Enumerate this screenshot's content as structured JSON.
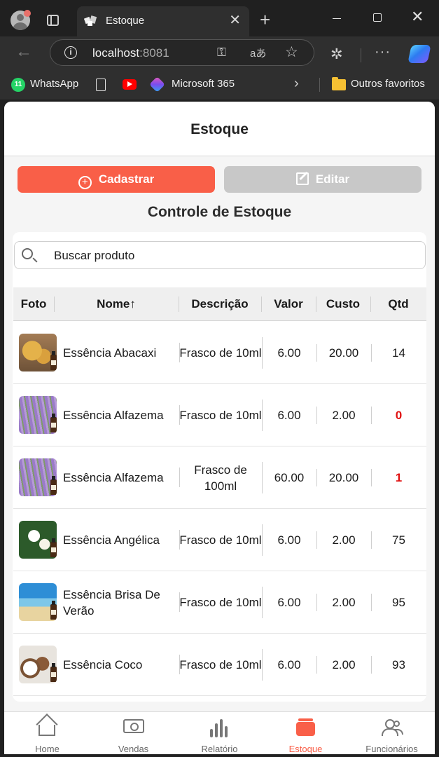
{
  "browser": {
    "tab_title": "Estoque",
    "url_host": "localhost",
    "url_port": ":8081",
    "bookmarks": [
      "WhatsApp",
      "Microsoft 365",
      "Outros favoritos"
    ],
    "whatsapp_badge": "11"
  },
  "app": {
    "header_title": "Estoque",
    "buttons": {
      "cadastrar": "Cadastrar",
      "editar": "Editar"
    },
    "section_title": "Controle de Estoque",
    "search_placeholder": "Buscar produto",
    "table": {
      "columns": [
        "Foto",
        "Nome",
        "Descrição",
        "Valor",
        "Custo",
        "Qtd"
      ],
      "sort_indicator": "↑",
      "rows": [
        {
          "photo": "abacaxi-photo",
          "nome": "Essência Abacaxi",
          "descricao": "Frasco de 10ml",
          "valor": "6.00",
          "custo": "20.00",
          "qtd": "14",
          "low_stock": false
        },
        {
          "photo": "lavender-photo",
          "nome": "Essência Alfazema",
          "descricao": "Frasco de 10ml",
          "valor": "6.00",
          "custo": "2.00",
          "qtd": "0",
          "low_stock": true
        },
        {
          "photo": "lavender-photo",
          "nome": "Essência Alfazema",
          "descricao": "Frasco de 100ml",
          "valor": "60.00",
          "custo": "20.00",
          "qtd": "1",
          "low_stock": true
        },
        {
          "photo": "angelica-photo",
          "nome": "Essência Angélica",
          "descricao": "Frasco de 10ml",
          "valor": "6.00",
          "custo": "2.00",
          "qtd": "75",
          "low_stock": false
        },
        {
          "photo": "beach-photo",
          "nome": "Essência Brisa De Verão",
          "descricao": "Frasco de 10ml",
          "valor": "6.00",
          "custo": "2.00",
          "qtd": "95",
          "low_stock": false
        },
        {
          "photo": "coconut-photo",
          "nome": "Essência Coco",
          "descricao": "Frasco de 10ml",
          "valor": "6.00",
          "custo": "2.00",
          "qtd": "93",
          "low_stock": false
        }
      ]
    },
    "nav": [
      {
        "label": "Home",
        "icon": "home-icon",
        "active": false
      },
      {
        "label": "Vendas",
        "icon": "money-icon",
        "active": false
      },
      {
        "label": "Relatório",
        "icon": "bar-chart-icon",
        "active": false
      },
      {
        "label": "Estoque",
        "icon": "box-icon",
        "active": true
      },
      {
        "label": "Funcionários",
        "icon": "people-icon",
        "active": false
      }
    ],
    "colors": {
      "accent": "#f95f48",
      "disabled": "#c8c8c8",
      "low_stock": "#e01010"
    }
  }
}
